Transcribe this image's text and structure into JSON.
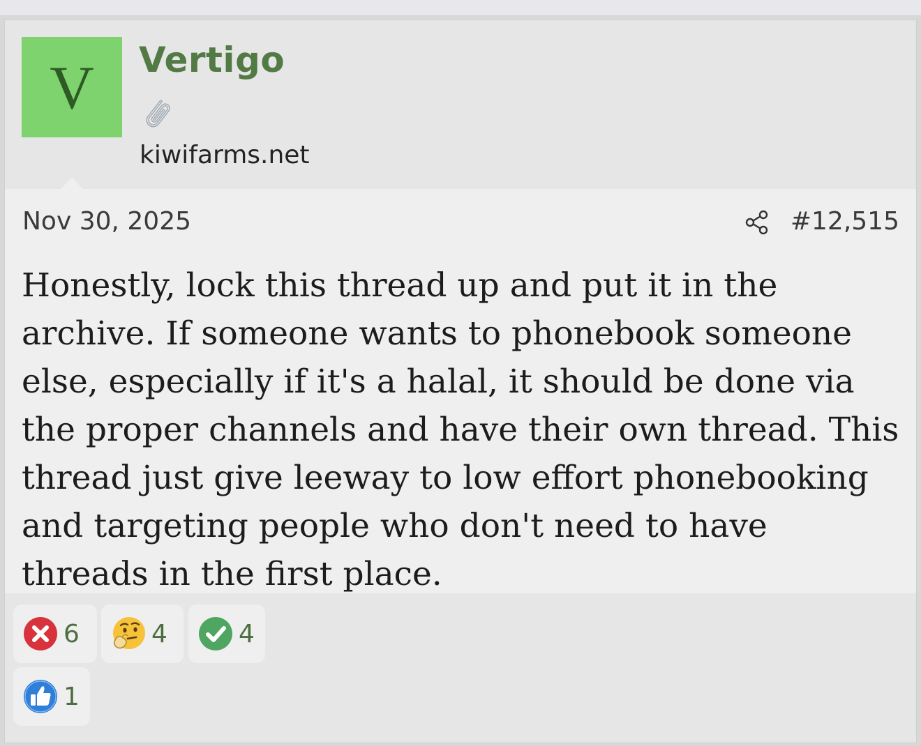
{
  "user": {
    "avatar_letter": "V",
    "name": "Vertigo",
    "title_icon": "paperclip-icon",
    "site": "kiwifarms.net"
  },
  "post": {
    "date": "Nov 30, 2025",
    "share_icon": "share-icon",
    "number": "#12,515",
    "body": "Honestly, lock this thread up and put it in the archive. If someone wants to phonebook someone else, especially if it's a halal, it should be done via the proper channels and have their own thread. This thread just give leeway to low effort phonebooking and targeting people who don't need to have threads in the first place."
  },
  "reactions": [
    {
      "icon": "red-x-icon",
      "count": "6"
    },
    {
      "icon": "thinking-face-icon",
      "count": "4"
    },
    {
      "icon": "green-check-icon",
      "count": "4"
    },
    {
      "icon": "thumbs-up-icon",
      "count": "1"
    }
  ],
  "colors": {
    "avatar_bg": "#7ed36e",
    "username": "#527a44",
    "reaction_count": "#4c6e3f",
    "x_red": "#d8323c",
    "check_green": "#4fa562",
    "like_blue": "#2f7fd8"
  }
}
